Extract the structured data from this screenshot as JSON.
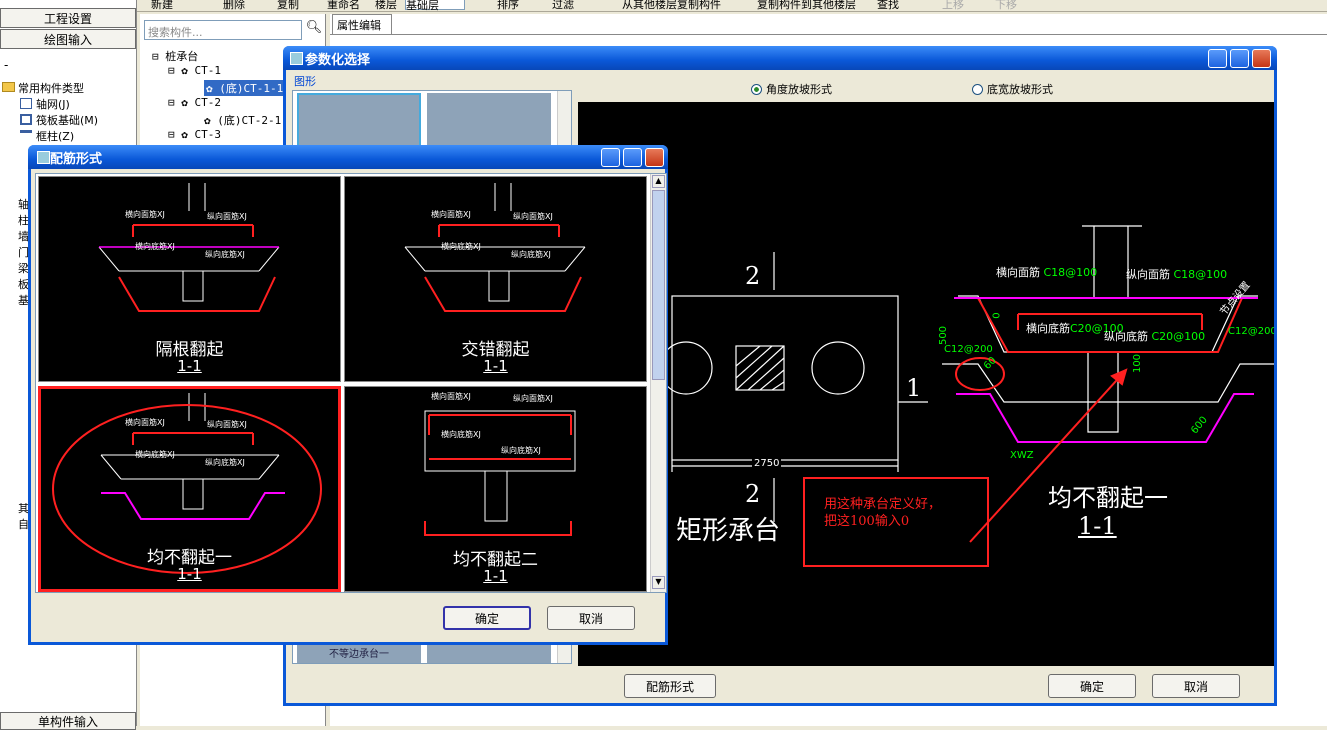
{
  "toolbar": {
    "new": "新建",
    "delete": "删除",
    "copy": "复制",
    "rename": "重命名",
    "floor": "楼层",
    "floor_value": "基础层",
    "sort": "排序",
    "filter": "过滤",
    "copy_from": "从其他楼层复制构件",
    "copy_to": "复制构件到其他楼层",
    "find": "查找",
    "up": "上移",
    "down": "下移"
  },
  "left": {
    "project_settings": "工程设置",
    "draw_input": "绘图输入",
    "bottom_item": "单构件输入",
    "types_header": "常用构件类型",
    "items": [
      {
        "label": "轴网(J)"
      },
      {
        "label": "筏板基础(M)"
      },
      {
        "label": "框柱(Z)"
      }
    ],
    "folders": [
      "轴",
      "柱",
      "墙",
      "门",
      "梁",
      "板",
      "基",
      "其",
      "自"
    ]
  },
  "tree": {
    "search_placeholder": "搜索构件...",
    "root": "桩承台",
    "nodes": [
      {
        "label": "CT-1"
      },
      {
        "label": "(底)CT-1-1"
      },
      {
        "label": "CT-2"
      },
      {
        "label": "(底)CT-2-1"
      },
      {
        "label": "CT-3"
      }
    ],
    "tab": "属性编辑"
  },
  "param_dialog": {
    "title": "参数化选择",
    "group_label": "图形",
    "radio_angle": "角度放坡形式",
    "radio_width": "底宽放坡形式",
    "thumb_bottom": "不等边承台一",
    "rebar_button": "配筋形式",
    "ok": "确定",
    "cancel": "取消",
    "cad": {
      "plan_label_top": "2",
      "plan_label_bottom": "2",
      "plan_label_right": "1",
      "dim_width": "2750",
      "plan_title": "矩形承台",
      "section_title": "均不翻起一",
      "section_sub": "1-1",
      "lbl_h_top": "横向面筋",
      "lbl_h_top_val": "C18@100",
      "lbl_v_top": "纵向面筋",
      "lbl_v_top_val": "C18@100",
      "lbl_h_bot": "横向底筋",
      "lbl_h_bot_val": "C20@100",
      "lbl_v_bot": "纵向底筋",
      "lbl_v_bot_val": "C20@100",
      "lbl_side_left": "C12@200",
      "lbl_side_right": "C12@200",
      "lbl_500": "500",
      "lbl_0": "0",
      "lbl_60": "60",
      "lbl_100": "100",
      "lbl_600": "600",
      "lbl_xwz": "XWZ",
      "lbl_shape": "节点设置",
      "annotation": "用这种承台定义好，\n把这100输入0"
    }
  },
  "rebar_dialog": {
    "title": "配筋形式",
    "options": [
      {
        "name": "隔根翻起",
        "sub": "1-1"
      },
      {
        "name": "交错翻起",
        "sub": "1-1"
      },
      {
        "name": "均不翻起一",
        "sub": "1-1"
      },
      {
        "name": "均不翻起二",
        "sub": "1-1"
      }
    ],
    "mini": {
      "h_top": "横向面筋XJ",
      "v_top": "纵向面筋XJ",
      "h_bot": "横向底筋XJ",
      "v_bot": "纵向底筋XJ"
    },
    "ok": "确定",
    "cancel": "取消"
  },
  "colors": {
    "accent_red": "#ff2020",
    "cad_green": "#00ff00",
    "cad_magenta": "#ff00ff",
    "title_blue": "#0a58d8"
  }
}
